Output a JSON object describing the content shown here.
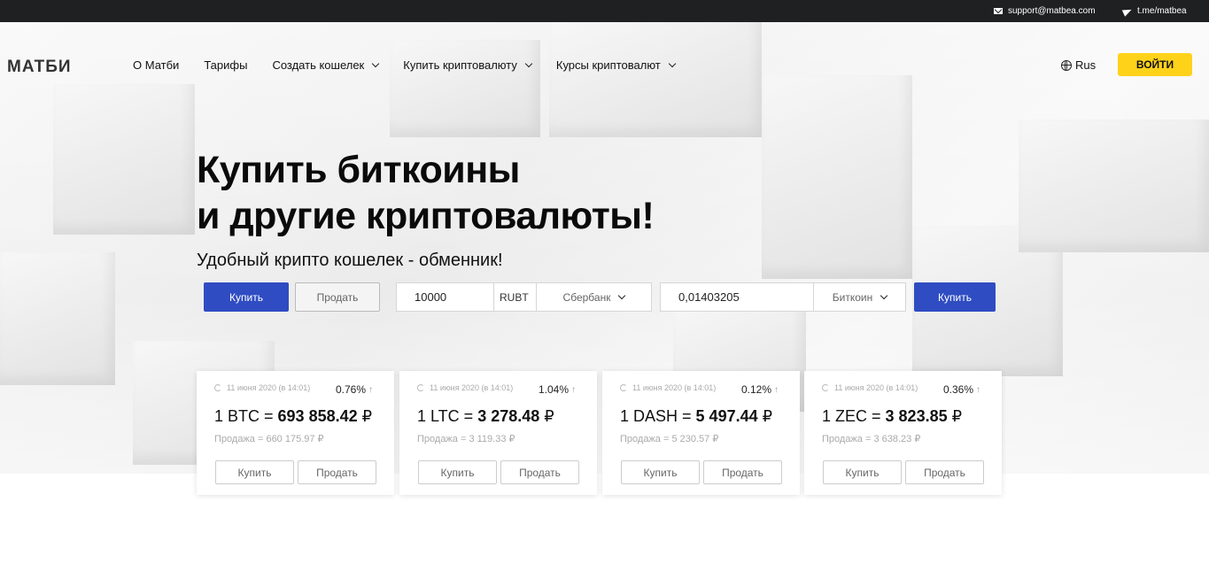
{
  "topbar": {
    "email": "support@matbea.com",
    "telegram": "t.me/matbea"
  },
  "header": {
    "logo": "МАТБИ",
    "nav": [
      {
        "label": "О Матби",
        "dropdown": false
      },
      {
        "label": "Тарифы",
        "dropdown": false
      },
      {
        "label": "Создать кошелек",
        "dropdown": true
      },
      {
        "label": "Купить криптовалюту",
        "dropdown": true
      },
      {
        "label": "Курсы криптовалют",
        "dropdown": true
      }
    ],
    "language": "Rus",
    "login_label": "ВОЙТИ"
  },
  "hero": {
    "title_line1": "Купить биткоины",
    "title_line2": "и другие криптовалюты!",
    "subtitle": "Удобный крипто кошелек - обменник!"
  },
  "exchange": {
    "buy_tab": "Купить",
    "sell_tab": "Продать",
    "amount": "10000",
    "amount_unit": "RUBT",
    "payment_method": "Сбербанк",
    "result_amount": "0,01403205",
    "result_currency": "Биткоин",
    "submit_label": "Купить"
  },
  "colors": {
    "accent_blue": "#2f4cc2",
    "login_yellow": "#ffd21a",
    "topbar": "#1f2022"
  },
  "rates": [
    {
      "date": "11 июня 2020 (в 14:01)",
      "change": "0.76%",
      "prefix": "1 BTC = ",
      "price": "693 858.42",
      "currency": "₽",
      "sell": "Продажа = 660 175.97 ₽",
      "buy_label": "Купить",
      "sell_label": "Продать"
    },
    {
      "date": "11 июня 2020 (в 14:01)",
      "change": "1.04%",
      "prefix": "1 LTC = ",
      "price": "3 278.48",
      "currency": "₽",
      "sell": "Продажа = 3 119.33 ₽",
      "buy_label": "Купить",
      "sell_label": "Продать"
    },
    {
      "date": "11 июня 2020 (в 14:01)",
      "change": "0.12%",
      "prefix": "1 DASH = ",
      "price": "5 497.44",
      "currency": "₽",
      "sell": "Продажа = 5 230.57 ₽",
      "buy_label": "Купить",
      "sell_label": "Продать"
    },
    {
      "date": "11 июня 2020 (в 14:01)",
      "change": "0.36%",
      "prefix": "1 ZEC = ",
      "price": "3 823.85",
      "currency": "₽",
      "sell": "Продажа = 3 638.23 ₽",
      "buy_label": "Купить",
      "sell_label": "Продать"
    }
  ]
}
